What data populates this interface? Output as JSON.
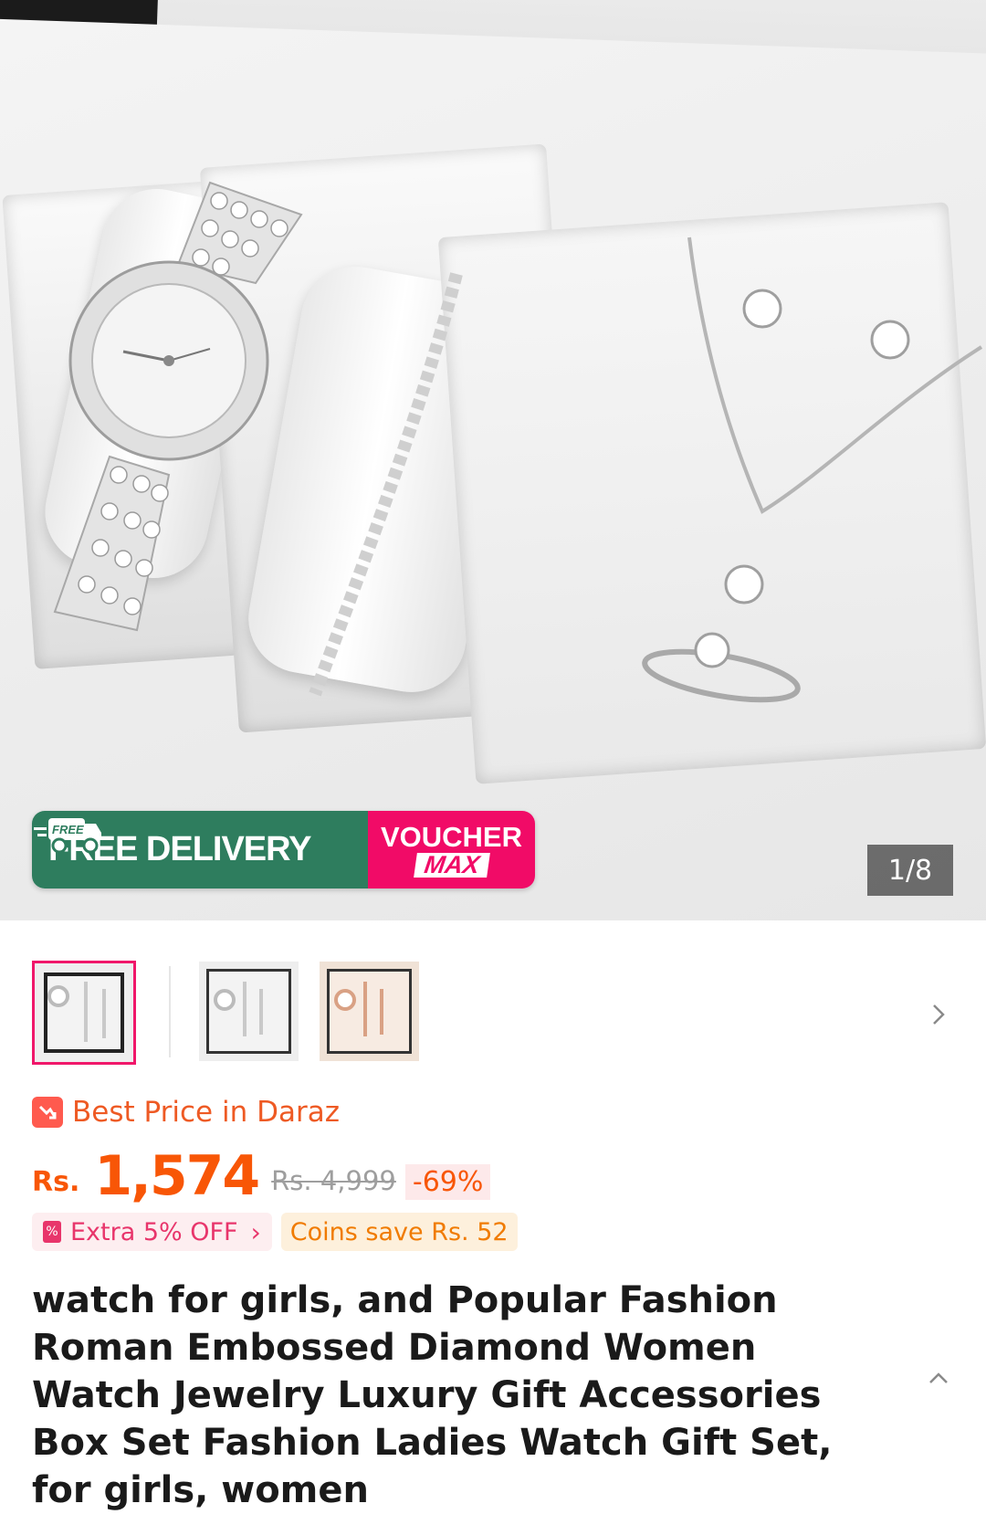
{
  "hero": {
    "promo_free_badge": "FREE",
    "promo_free_delivery": "FREE DELIVERY",
    "promo_voucher": "VOUCHER",
    "promo_max": "MAX",
    "image_counter": "1/8"
  },
  "thumbnails": {
    "count_visible": 3,
    "active_index": 0
  },
  "price": {
    "badge_text": "Best Price in Daraz",
    "currency": "Rs.",
    "current": "1,574",
    "original": "Rs. 4,999",
    "discount": "-69%",
    "extra_off": "Extra 5% OFF",
    "coins_save": "Coins save Rs. 52"
  },
  "product": {
    "title": "watch for girls, and Popular Fashion Roman Embossed Diamond Women Watch Jewelry Luxury Gift Accessories Box Set Fashion Ladies Watch Gift Set, for girls, women"
  },
  "icons": {
    "next": "chevron-right-icon",
    "collapse": "chevron-up-icon",
    "truck": "truck-icon"
  },
  "colors": {
    "accent": "#f85606",
    "voucher_pink": "#f10b67",
    "delivery_green": "#2e7d5e"
  }
}
